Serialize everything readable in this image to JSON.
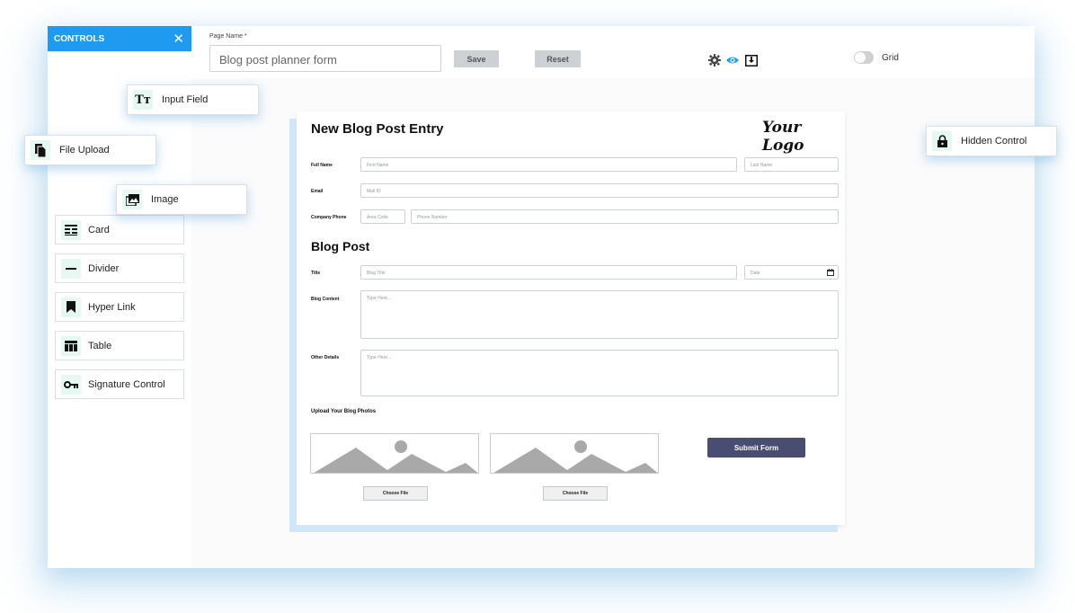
{
  "sidebar": {
    "title": "CONTROLS",
    "close_icon": "close-icon",
    "items": [
      {
        "label": "Card",
        "icon": "card-icon"
      },
      {
        "label": "Divider",
        "icon": "divider-icon"
      },
      {
        "label": "Hyper Link",
        "icon": "bookmark-icon"
      },
      {
        "label": "Table",
        "icon": "table-icon"
      },
      {
        "label": "Signature Control",
        "icon": "key-icon"
      }
    ]
  },
  "floating": [
    {
      "label": "Input Field",
      "icon": "text-icon"
    },
    {
      "label": "File Upload",
      "icon": "file-icon"
    },
    {
      "label": "Image",
      "icon": "image-icon"
    },
    {
      "label": "Hidden Control",
      "icon": "lock-icon"
    }
  ],
  "topbar": {
    "page_name_label": "Page Name *",
    "page_name_value": "Blog post planner form",
    "save_label": "Save",
    "reset_label": "Reset",
    "grid_label": "Grid",
    "grid_on": false,
    "accent_color": "#1e9bf0"
  },
  "form": {
    "title": "New Blog Post Entry",
    "logo": "Your Logo",
    "full_name_label": "Full Name",
    "first_name_ph": "First Name",
    "last_name_ph": "Last Name",
    "email_label": "Email",
    "email_ph": "Mail ID",
    "phone_label": "Company Phone",
    "area_code_ph": "Area Code",
    "phone_ph": "Phone Number",
    "section_title": "Blog Post",
    "title_label": "Title",
    "blog_title_ph": "Blog Title",
    "date_ph": "Date",
    "content_label": "Blog Content",
    "content_ph": "Type Here...",
    "other_label": "Other Details",
    "other_ph": "Type Here...",
    "upload_label": "Upload Your Blog Photos",
    "choose_file_1": "Choose File",
    "choose_file_2": "Choose File",
    "submit_label": "Submit Form",
    "submit_color": "#4a4d72"
  }
}
